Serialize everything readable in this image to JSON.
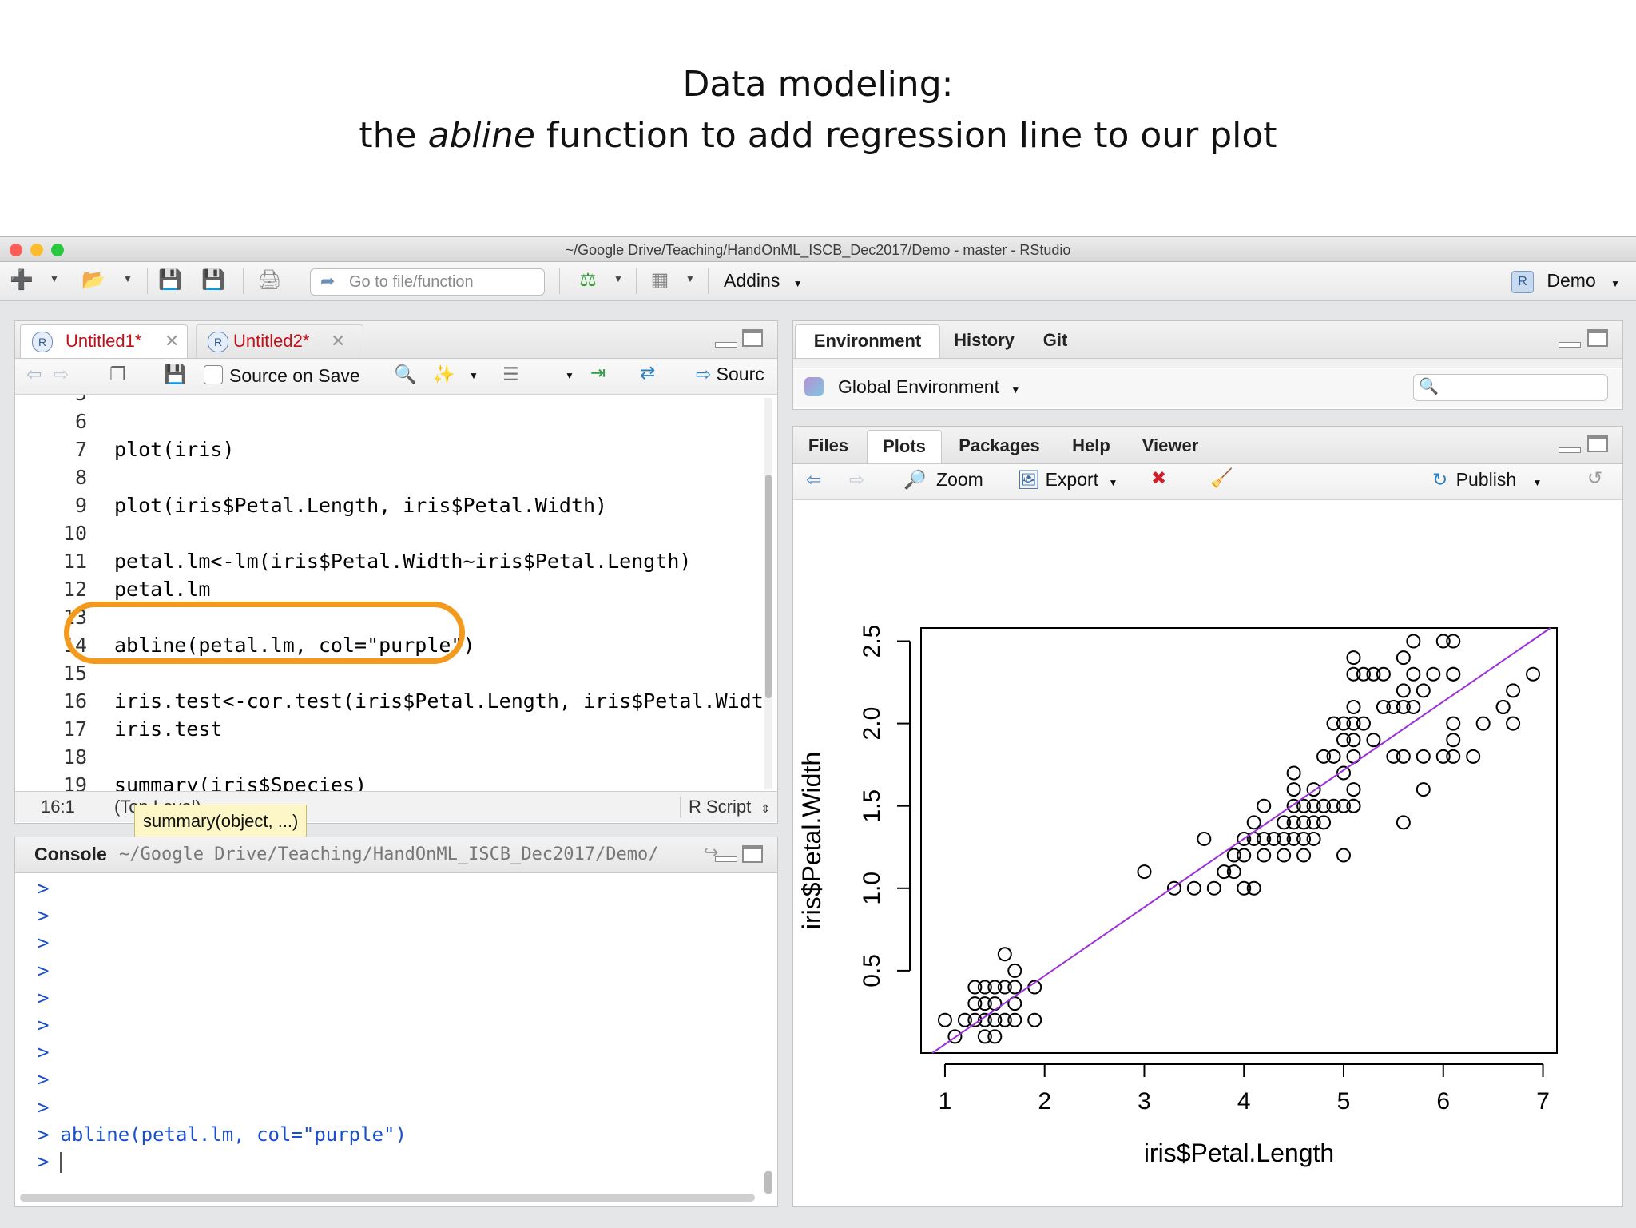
{
  "slide": {
    "title_line1": "Data modeling:",
    "title_line2_pre": "the ",
    "title_line2_em": "abline",
    "title_line2_post": " function to add regression line to our plot"
  },
  "window": {
    "title": "~/Google Drive/Teaching/HandOnML_ISCB_Dec2017/Demo - master - RStudio",
    "traffic_colors": [
      "#fc5f57",
      "#fdbc2e",
      "#29c840"
    ]
  },
  "toolbar": {
    "goto_placeholder": "Go to file/function",
    "addins_label": "Addins",
    "project_label": "Demo"
  },
  "editor": {
    "tabs": [
      {
        "label": "Untitled1*",
        "color": "#c0101a"
      },
      {
        "label": "Untitled2*",
        "color": "#c0101a"
      }
    ],
    "source_on_save": "Source on Save",
    "source_label": "Sourc",
    "lines": [
      {
        "num": "6",
        "code": ""
      },
      {
        "num": "7",
        "code": "plot(iris)"
      },
      {
        "num": "8",
        "code": ""
      },
      {
        "num": "9",
        "code": "plot(iris$Petal.Length, iris$Petal.Width)"
      },
      {
        "num": "10",
        "code": ""
      },
      {
        "num": "11",
        "code": "petal.lm<-lm(iris$Petal.Width~iris$Petal.Length)"
      },
      {
        "num": "12",
        "code": "petal.lm"
      },
      {
        "num": "13",
        "code": ""
      },
      {
        "num": "14",
        "code": "abline(petal.lm, col=\"purple\")"
      },
      {
        "num": "15",
        "code": ""
      },
      {
        "num": "16",
        "code": "iris.test<-cor.test(iris$Petal.Length, iris$Petal.Width)"
      },
      {
        "num": "17",
        "code": "iris.test"
      },
      {
        "num": "18",
        "code": ""
      },
      {
        "num": "19",
        "code": "summary(iris$Species)"
      }
    ],
    "status_position": "16:1",
    "status_scope": "(Top Level)",
    "status_type": "R Script",
    "tooltip": "summary(object, ...)"
  },
  "console": {
    "title": "Console",
    "path": "~/Google Drive/Teaching/HandOnML_ISCB_Dec2017/Demo/",
    "prompt": ">",
    "empty_prompt_count": 9,
    "last_command": "abline(petal.lm, col=\"purple\")"
  },
  "environment": {
    "tabs": [
      "Environment",
      "History",
      "Git"
    ],
    "scope": "Global Environment"
  },
  "files": {
    "tabs": [
      "Files",
      "Plots",
      "Packages",
      "Help",
      "Viewer"
    ],
    "zoom": "Zoom",
    "export": "Export",
    "publish": "Publish"
  },
  "chart_data": {
    "type": "scatter",
    "xlabel": "iris$Petal.Length",
    "ylabel": "iris$Petal.Width",
    "xticks": [
      "1",
      "2",
      "3",
      "4",
      "5",
      "6",
      "7"
    ],
    "yticks": [
      "0.5",
      "1.0",
      "1.5",
      "2.0",
      "2.5"
    ],
    "xlim": [
      0.76,
      7.14
    ],
    "ylim": [
      0.0,
      2.58
    ],
    "line_color": "#9b30d9",
    "regression_line": {
      "intercept": -0.363,
      "slope": 0.416
    },
    "points": [
      [
        1.1,
        0.1
      ],
      [
        1.4,
        0.1
      ],
      [
        1.5,
        0.1
      ],
      [
        1.3,
        0.2
      ],
      [
        1.4,
        0.2
      ],
      [
        1.5,
        0.2
      ],
      [
        1.6,
        0.2
      ],
      [
        1.2,
        0.2
      ],
      [
        1.0,
        0.2
      ],
      [
        1.7,
        0.2
      ],
      [
        1.9,
        0.2
      ],
      [
        1.3,
        0.3
      ],
      [
        1.4,
        0.3
      ],
      [
        1.5,
        0.3
      ],
      [
        1.7,
        0.3
      ],
      [
        1.4,
        0.4
      ],
      [
        1.5,
        0.4
      ],
      [
        1.6,
        0.4
      ],
      [
        1.7,
        0.4
      ],
      [
        1.9,
        0.4
      ],
      [
        1.3,
        0.4
      ],
      [
        1.6,
        0.6
      ],
      [
        1.7,
        0.5
      ],
      [
        3.0,
        1.1
      ],
      [
        3.3,
        1.0
      ],
      [
        3.5,
        1.0
      ],
      [
        3.7,
        1.0
      ],
      [
        4.0,
        1.0
      ],
      [
        4.1,
        1.0
      ],
      [
        3.9,
        1.1
      ],
      [
        3.8,
        1.1
      ],
      [
        4.0,
        1.2
      ],
      [
        3.9,
        1.2
      ],
      [
        4.2,
        1.2
      ],
      [
        4.4,
        1.2
      ],
      [
        4.6,
        1.2
      ],
      [
        5.0,
        1.2
      ],
      [
        3.6,
        1.3
      ],
      [
        4.0,
        1.3
      ],
      [
        4.1,
        1.3
      ],
      [
        4.2,
        1.3
      ],
      [
        4.3,
        1.3
      ],
      [
        4.4,
        1.3
      ],
      [
        4.5,
        1.3
      ],
      [
        4.6,
        1.3
      ],
      [
        4.7,
        1.3
      ],
      [
        4.1,
        1.4
      ],
      [
        4.4,
        1.4
      ],
      [
        4.5,
        1.4
      ],
      [
        4.6,
        1.4
      ],
      [
        4.7,
        1.4
      ],
      [
        4.8,
        1.4
      ],
      [
        5.1,
        1.5
      ],
      [
        4.2,
        1.5
      ],
      [
        4.5,
        1.5
      ],
      [
        4.6,
        1.5
      ],
      [
        4.7,
        1.5
      ],
      [
        4.9,
        1.5
      ],
      [
        5.0,
        1.5
      ],
      [
        4.8,
        1.5
      ],
      [
        5.1,
        1.5
      ],
      [
        4.5,
        1.6
      ],
      [
        5.1,
        1.6
      ],
      [
        4.7,
        1.6
      ],
      [
        4.5,
        1.7
      ],
      [
        5.0,
        1.7
      ],
      [
        4.9,
        1.8
      ],
      [
        4.8,
        1.8
      ],
      [
        5.1,
        1.8
      ],
      [
        5.5,
        1.8
      ],
      [
        5.6,
        1.8
      ],
      [
        5.8,
        1.8
      ],
      [
        6.0,
        1.8
      ],
      [
        6.3,
        1.8
      ],
      [
        5.0,
        1.9
      ],
      [
        5.1,
        1.9
      ],
      [
        5.3,
        1.9
      ],
      [
        6.1,
        1.9
      ],
      [
        4.9,
        2.0
      ],
      [
        5.0,
        2.0
      ],
      [
        5.1,
        2.0
      ],
      [
        5.2,
        2.0
      ],
      [
        5.1,
        2.1
      ],
      [
        5.4,
        2.1
      ],
      [
        5.5,
        2.1
      ],
      [
        5.6,
        2.1
      ],
      [
        5.7,
        2.1
      ],
      [
        6.6,
        2.1
      ],
      [
        5.6,
        2.2
      ],
      [
        5.8,
        2.2
      ],
      [
        6.7,
        2.2
      ],
      [
        6.1,
        2.3
      ],
      [
        5.1,
        2.3
      ],
      [
        5.2,
        2.3
      ],
      [
        5.3,
        2.3
      ],
      [
        5.4,
        2.3
      ],
      [
        5.7,
        2.3
      ],
      [
        5.9,
        2.3
      ],
      [
        6.1,
        2.3
      ],
      [
        6.9,
        2.3
      ],
      [
        5.1,
        2.4
      ],
      [
        5.6,
        2.4
      ],
      [
        5.7,
        2.5
      ],
      [
        6.0,
        2.5
      ],
      [
        6.1,
        2.5
      ],
      [
        5.6,
        1.4
      ],
      [
        5.8,
        1.6
      ],
      [
        6.1,
        2.0
      ],
      [
        6.4,
        2.0
      ],
      [
        6.7,
        2.0
      ],
      [
        6.6,
        2.1
      ],
      [
        6.1,
        1.8
      ]
    ]
  }
}
